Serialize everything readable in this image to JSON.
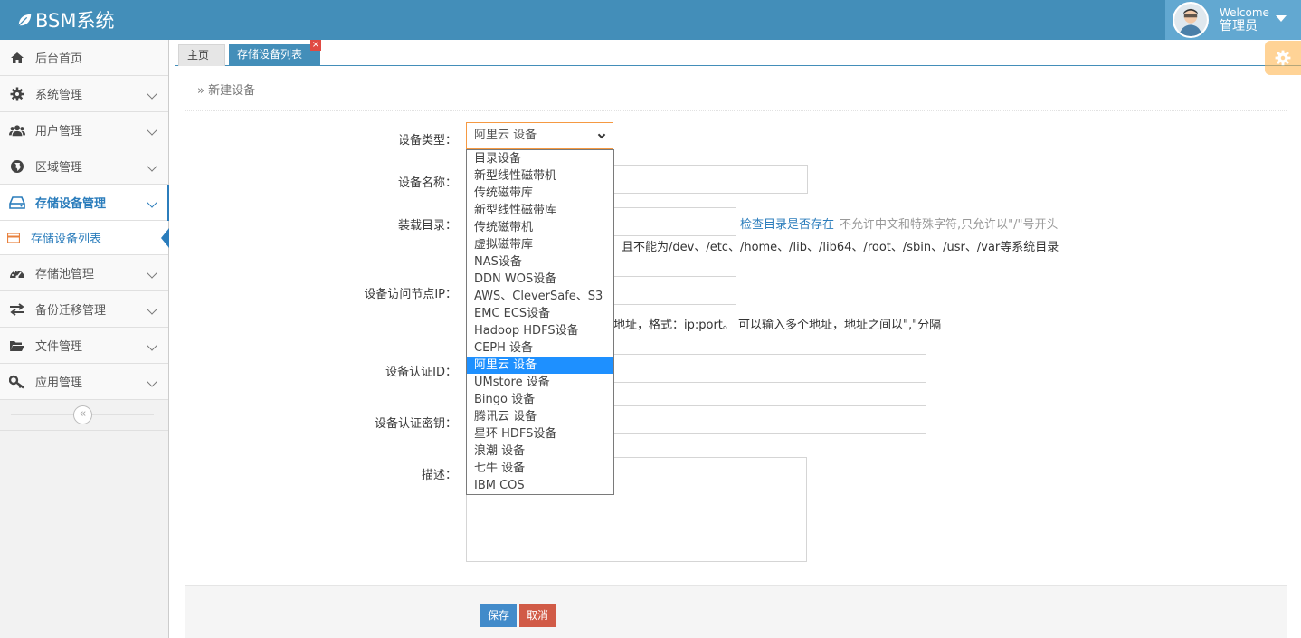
{
  "app": {
    "brand": "BSM系统",
    "user": {
      "welcome": "Welcome",
      "name": "管理员"
    }
  },
  "sidebar": {
    "items": [
      {
        "label": "后台首页",
        "icon": "home-icon",
        "expandable": false
      },
      {
        "label": "系统管理",
        "icon": "gear-icon",
        "expandable": true
      },
      {
        "label": "用户管理",
        "icon": "users-icon",
        "expandable": true
      },
      {
        "label": "区域管理",
        "icon": "globe-icon",
        "expandable": true
      },
      {
        "label": "存储设备管理",
        "icon": "hdd-icon",
        "expandable": true,
        "active": true
      },
      {
        "label": "存储池管理",
        "icon": "dashboard-icon",
        "expandable": true
      },
      {
        "label": "备份迁移管理",
        "icon": "exchange-icon",
        "expandable": true
      },
      {
        "label": "文件管理",
        "icon": "folder-open-icon",
        "expandable": true
      },
      {
        "label": "应用管理",
        "icon": "key-icon",
        "expandable": true
      }
    ],
    "sub_item": {
      "label": "存储设备列表",
      "icon": "credit-card-icon"
    },
    "collapse_icon": "«"
  },
  "tabs": {
    "home": "主页",
    "active": "存储设备列表",
    "close": "×"
  },
  "breadcrumb": "» 新建设备",
  "form": {
    "device_type_label": "设备类型：",
    "device_type_value": "阿里云 设备",
    "device_name_label": "设备名称：",
    "mount_dir_label": "装载目录：",
    "check_dir_link": "检查目录是否存在",
    "mount_hint_1": "不允许中文和特殊字符,只允许以\"/\"号开头",
    "mount_hint_2": "且不能为/dev、/etc、/home、/lib、/lib64、/root、/sbin、/usr、/var等系统目录",
    "node_ip_label": "设备访问节点IP：",
    "node_ip_hint": "地址，格式：ip:port。 可以输入多个地址，地址之间以\",\"分隔",
    "auth_id_label": "设备认证ID：",
    "auth_key_label": "设备认证密钥：",
    "desc_label": "描述："
  },
  "dropdown": {
    "options": [
      "目录设备",
      "新型线性磁带机",
      "传统磁带库",
      "新型线性磁带库",
      "传统磁带机",
      "虚拟磁带库",
      "NAS设备",
      "DDN WOS设备",
      "AWS、CleverSafe、S3",
      "EMC ECS设备",
      "Hadoop HDFS设备",
      "CEPH 设备",
      "阿里云 设备",
      "UMstore 设备",
      "Bingo 设备",
      "腾讯云 设备",
      "星环 HDFS设备",
      "浪潮 设备",
      "七牛 设备",
      "IBM COS"
    ],
    "selected": "阿里云 设备"
  },
  "actions": {
    "save": "保存",
    "cancel": "取消"
  },
  "colors": {
    "navbar": "#438eb9",
    "user_box": "#62a8d1",
    "active": "#2b7dbc",
    "save": "#428bca",
    "cancel": "#d15b47",
    "select_focus": "#f59942",
    "option_selected": "#1e90ff"
  }
}
